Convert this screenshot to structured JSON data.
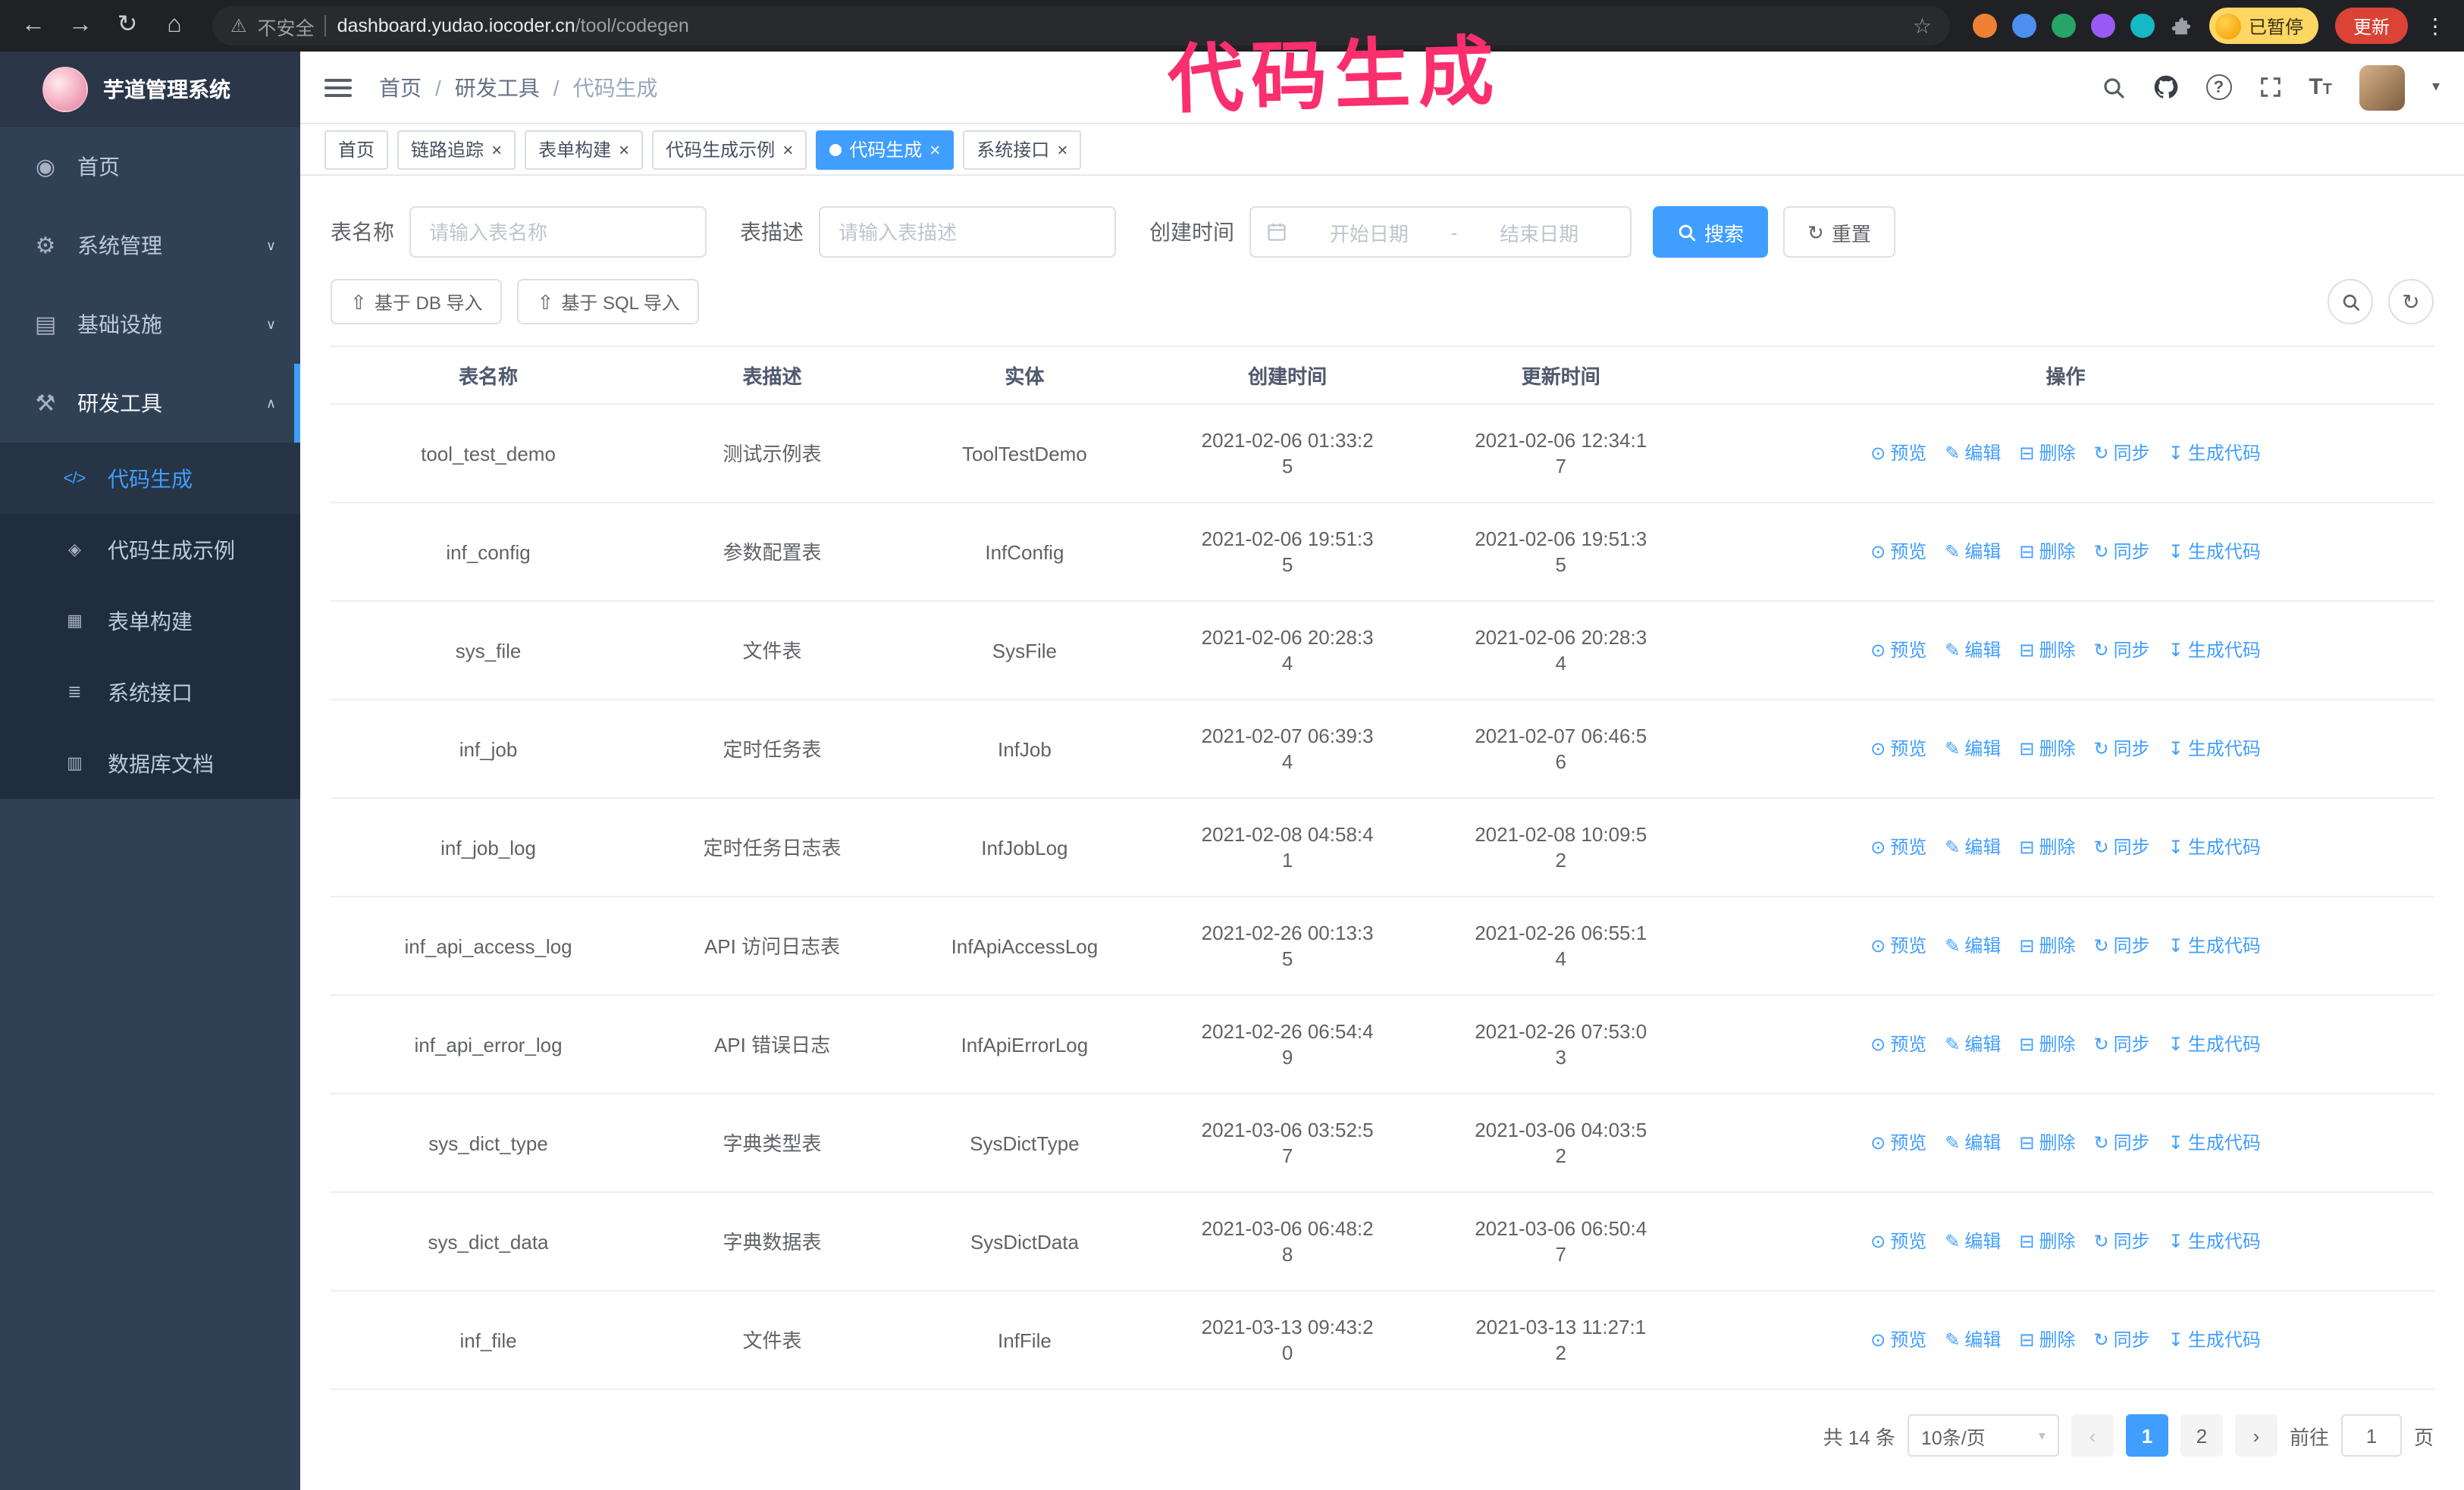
{
  "icons": {
    "back": "←",
    "forward": "→",
    "reload": "↻",
    "home": "⌂",
    "warning": "⚠",
    "star": "☆",
    "kebab": "⋮",
    "close": "×",
    "question": "?",
    "upload": "⇧",
    "refresh": "↻",
    "eye": "⊙",
    "edit": "✎",
    "trash": "⊟",
    "sync": "↻",
    "download": "↧",
    "chevron_down": "∨",
    "chevron_up": "∧",
    "caret_down": "▾",
    "prev": "‹",
    "next": "›"
  },
  "browser": {
    "security_label": "不安全",
    "url_host": "dashboard.yudao.iocoder.cn",
    "url_path": "/tool/codegen",
    "profile_badge": "已暂停",
    "update_button": "更新"
  },
  "annotation": {
    "text": "代码生成",
    "color": "#fb2e6e"
  },
  "sidebar": {
    "logo_title": "芋道管理系统",
    "items": [
      {
        "icon": "◉",
        "label": "首页"
      },
      {
        "icon": "⚙",
        "label": "系统管理",
        "chevron": "∨"
      },
      {
        "icon": "▤",
        "label": "基础设施",
        "chevron": "∨"
      },
      {
        "icon": "⚒",
        "label": "研发工具",
        "chevron": "∧"
      }
    ],
    "subitems": [
      {
        "icon": "</>",
        "label": "代码生成"
      },
      {
        "icon": "◈",
        "label": "代码生成示例"
      },
      {
        "icon": "▦",
        "label": "表单构建"
      },
      {
        "icon": "≣",
        "label": "系统接口"
      },
      {
        "icon": "▥",
        "label": "数据库文档"
      }
    ]
  },
  "breadcrumb": {
    "separator": "/",
    "items": [
      "首页",
      "研发工具",
      "代码生成"
    ]
  },
  "tabs": [
    {
      "label": "首页"
    },
    {
      "label": "链路追踪"
    },
    {
      "label": "表单构建"
    },
    {
      "label": "代码生成示例"
    },
    {
      "label": "代码生成"
    },
    {
      "label": "系统接口"
    }
  ],
  "filters": {
    "table_name": {
      "label": "表名称",
      "placeholder": "请输入表名称"
    },
    "table_desc": {
      "label": "表描述",
      "placeholder": "请输入表描述"
    },
    "create_time": {
      "label": "创建时间",
      "start_placeholder": "开始日期",
      "separator": "-",
      "end_placeholder": "结束日期"
    },
    "search_label": "搜索",
    "reset_label": "重置"
  },
  "toolbar": {
    "import_db_label": "基于 DB 导入",
    "import_sql_label": "基于 SQL 导入"
  },
  "table": {
    "columns": [
      "表名称",
      "表描述",
      "实体",
      "创建时间",
      "更新时间",
      "操作"
    ],
    "action_labels": [
      "预览",
      "编辑",
      "删除",
      "同步",
      "生成代码"
    ],
    "rows": [
      {
        "name": "tool_test_demo",
        "desc": "测试示例表",
        "entity": "ToolTestDemo",
        "created": "2021-02-06 01:33:25",
        "updated": "2021-02-06 12:34:17"
      },
      {
        "name": "inf_config",
        "desc": "参数配置表",
        "entity": "InfConfig",
        "created": "2021-02-06 19:51:35",
        "updated": "2021-02-06 19:51:35"
      },
      {
        "name": "sys_file",
        "desc": "文件表",
        "entity": "SysFile",
        "created": "2021-02-06 20:28:34",
        "updated": "2021-02-06 20:28:34"
      },
      {
        "name": "inf_job",
        "desc": "定时任务表",
        "entity": "InfJob",
        "created": "2021-02-07 06:39:34",
        "updated": "2021-02-07 06:46:56"
      },
      {
        "name": "inf_job_log",
        "desc": "定时任务日志表",
        "entity": "InfJobLog",
        "created": "2021-02-08 04:58:41",
        "updated": "2021-02-08 10:09:52"
      },
      {
        "name": "inf_api_access_log",
        "desc": "API 访问日志表",
        "entity": "InfApiAccessLog",
        "created": "2021-02-26 00:13:35",
        "updated": "2021-02-26 06:55:14"
      },
      {
        "name": "inf_api_error_log",
        "desc": "API 错误日志",
        "entity": "InfApiErrorLog",
        "created": "2021-02-26 06:54:49",
        "updated": "2021-02-26 07:53:03"
      },
      {
        "name": "sys_dict_type",
        "desc": "字典类型表",
        "entity": "SysDictType",
        "created": "2021-03-06 03:52:57",
        "updated": "2021-03-06 04:03:52"
      },
      {
        "name": "sys_dict_data",
        "desc": "字典数据表",
        "entity": "SysDictData",
        "created": "2021-03-06 06:48:28",
        "updated": "2021-03-06 06:50:47"
      },
      {
        "name": "inf_file",
        "desc": "文件表",
        "entity": "InfFile",
        "created": "2021-03-13 09:43:20",
        "updated": "2021-03-13 11:27:12"
      }
    ]
  },
  "pagination": {
    "total_label": "共 14 条",
    "page_size_label": "10条/页",
    "pages": [
      "1",
      "2"
    ],
    "goto_label": "前往",
    "goto_value": "1",
    "goto_unit": "页"
  }
}
